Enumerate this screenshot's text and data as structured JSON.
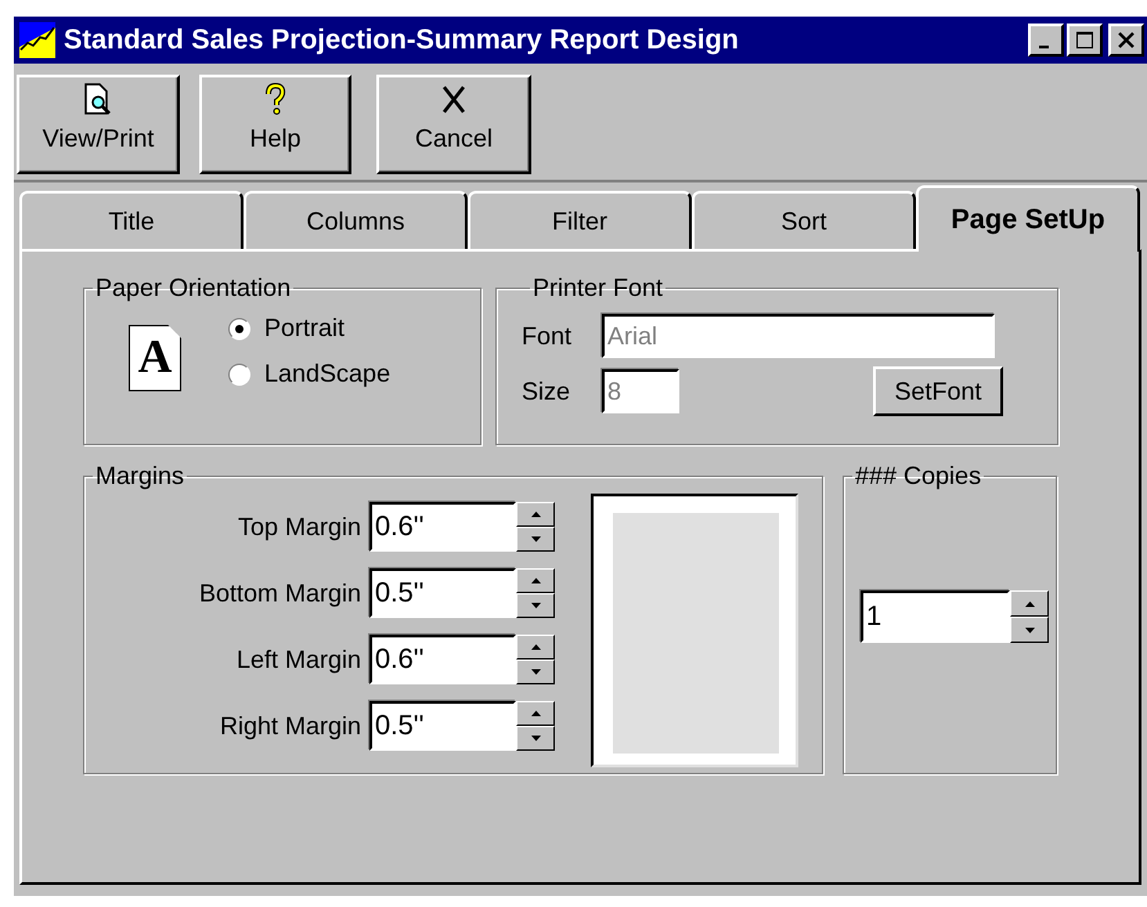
{
  "window": {
    "title": "Standard Sales Projection-Summary Report Design"
  },
  "toolbar": [
    {
      "label": "View/Print",
      "kind": "view"
    },
    {
      "label": "Help",
      "kind": "help"
    },
    {
      "label": "Cancel",
      "kind": "cancel"
    }
  ],
  "tabs": [
    {
      "label": "Title",
      "selected": false
    },
    {
      "label": "Columns",
      "selected": false
    },
    {
      "label": "Filter",
      "selected": false
    },
    {
      "label": "Sort",
      "selected": false
    },
    {
      "label": "Page SetUp",
      "selected": true
    }
  ],
  "orientation": {
    "title": "Paper Orientation",
    "icon_glyph": "A",
    "options": [
      {
        "label": "Portrait",
        "selected": true
      },
      {
        "label": "LandScape",
        "selected": false
      }
    ]
  },
  "printer_font": {
    "title": "Printer Font",
    "font_label": "Font",
    "font_value": "Arial",
    "size_label": "Size",
    "size_value": "8",
    "disabled": true,
    "button": "SetFont"
  },
  "margins": {
    "title": "Margins",
    "rows": [
      {
        "label": "Top Margin",
        "value": "0.6''"
      },
      {
        "label": "Bottom Margin",
        "value": "0.5''"
      },
      {
        "label": "Left Margin",
        "value": "0.6''"
      },
      {
        "label": "Right Margin",
        "value": "0.5''"
      }
    ]
  },
  "copies": {
    "title": "### Copies",
    "value": "1"
  }
}
